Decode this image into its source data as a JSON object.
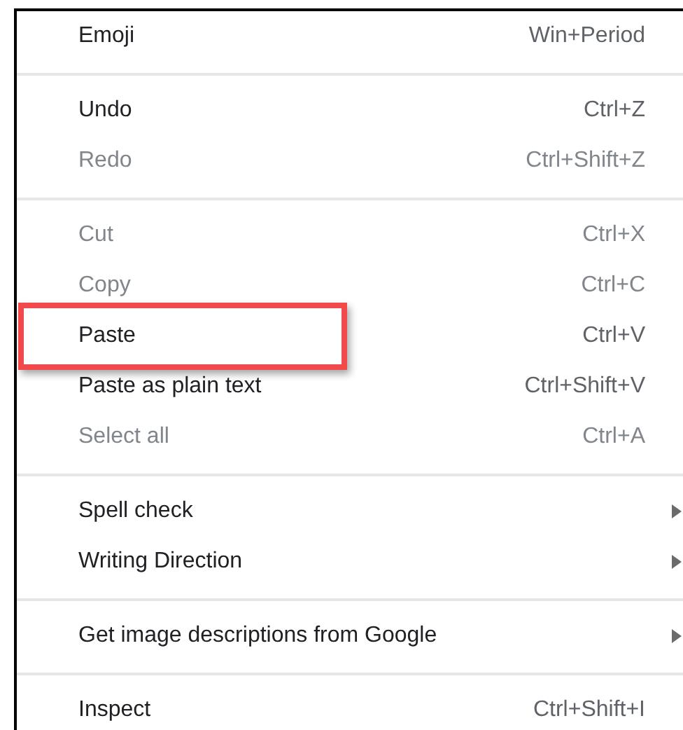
{
  "menu": {
    "sections": [
      {
        "items": [
          {
            "label": "Emoji",
            "shortcut": "Win+Period",
            "disabled": false,
            "submenu": false,
            "highlighted": false
          }
        ]
      },
      {
        "items": [
          {
            "label": "Undo",
            "shortcut": "Ctrl+Z",
            "disabled": false,
            "submenu": false,
            "highlighted": false
          },
          {
            "label": "Redo",
            "shortcut": "Ctrl+Shift+Z",
            "disabled": true,
            "submenu": false,
            "highlighted": false
          }
        ]
      },
      {
        "items": [
          {
            "label": "Cut",
            "shortcut": "Ctrl+X",
            "disabled": true,
            "submenu": false,
            "highlighted": false
          },
          {
            "label": "Copy",
            "shortcut": "Ctrl+C",
            "disabled": true,
            "submenu": false,
            "highlighted": false
          },
          {
            "label": "Paste",
            "shortcut": "Ctrl+V",
            "disabled": false,
            "submenu": false,
            "highlighted": true
          },
          {
            "label": "Paste as plain text",
            "shortcut": "Ctrl+Shift+V",
            "disabled": false,
            "submenu": false,
            "highlighted": false
          },
          {
            "label": "Select all",
            "shortcut": "Ctrl+A",
            "disabled": true,
            "submenu": false,
            "highlighted": false
          }
        ]
      },
      {
        "items": [
          {
            "label": "Spell check",
            "disabled": false,
            "submenu": true,
            "highlighted": false
          },
          {
            "label": "Writing Direction",
            "disabled": false,
            "submenu": true,
            "highlighted": false
          }
        ]
      },
      {
        "items": [
          {
            "label": "Get image descriptions from Google",
            "disabled": false,
            "submenu": true,
            "highlighted": false
          }
        ]
      },
      {
        "items": [
          {
            "label": "Inspect",
            "shortcut": "Ctrl+Shift+I",
            "disabled": false,
            "submenu": false,
            "highlighted": false
          }
        ]
      }
    ]
  }
}
